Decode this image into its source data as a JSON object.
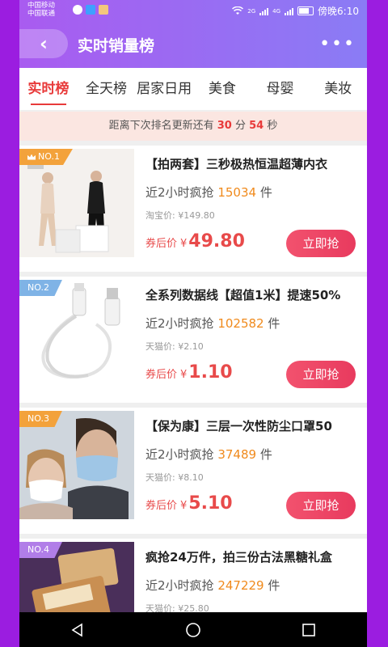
{
  "statusbar": {
    "carrier1": "中国移动",
    "carrier2": "中国联通",
    "net1": "2G",
    "net2": "4G",
    "time": "傍晚6:10"
  },
  "header": {
    "title": "实时销量榜",
    "more": "•••",
    "back_icon": "chevron-left-icon"
  },
  "tabs": [
    {
      "label": "实时榜",
      "active": true
    },
    {
      "label": "全天榜"
    },
    {
      "label": "居家日用"
    },
    {
      "label": "美食"
    },
    {
      "label": "母婴"
    },
    {
      "label": "美妆"
    }
  ],
  "countdown": {
    "prefix": "距离下次排名更新还有",
    "minutes": "30",
    "minutes_unit": "分",
    "seconds": "54",
    "seconds_unit": "秒"
  },
  "products": [
    {
      "rank": "NO.1",
      "title": "【拍两套】三秒极热恒温超薄内衣",
      "sold_prefix": "近2小时疯抢",
      "sold_count": "15034",
      "sold_suffix": "件",
      "orig_price": "淘宝价: ¥149.80",
      "price_label": "券后价",
      "yen": "¥",
      "price": "49.80",
      "button": "立即抢"
    },
    {
      "rank": "NO.2",
      "title": "全系列数据线【超值1米】提速50%",
      "sold_prefix": "近2小时疯抢",
      "sold_count": "102582",
      "sold_suffix": "件",
      "orig_price": "天猫价: ¥2.10",
      "price_label": "券后价",
      "yen": "¥",
      "price": "1.10",
      "button": "立即抢"
    },
    {
      "rank": "NO.3",
      "title": "【保为康】三层一次性防尘口罩50",
      "sold_prefix": "近2小时疯抢",
      "sold_count": "37489",
      "sold_suffix": "件",
      "orig_price": "天猫价: ¥8.10",
      "price_label": "券后价",
      "yen": "¥",
      "price": "5.10",
      "button": "立即抢"
    },
    {
      "rank": "NO.4",
      "title": "疯抢24万件，拍三份古法黑糖礼盒",
      "sold_prefix": "近2小时疯抢",
      "sold_count": "247229",
      "sold_suffix": "件",
      "orig_price": "天猫价: ¥25.80"
    }
  ],
  "colors": {
    "accent": "#e83a3a",
    "header_gradient_start": "#a95bf0",
    "header_gradient_end": "#8a7cf5",
    "sold_count": "#f08a1c",
    "button": "#e83a5e"
  }
}
